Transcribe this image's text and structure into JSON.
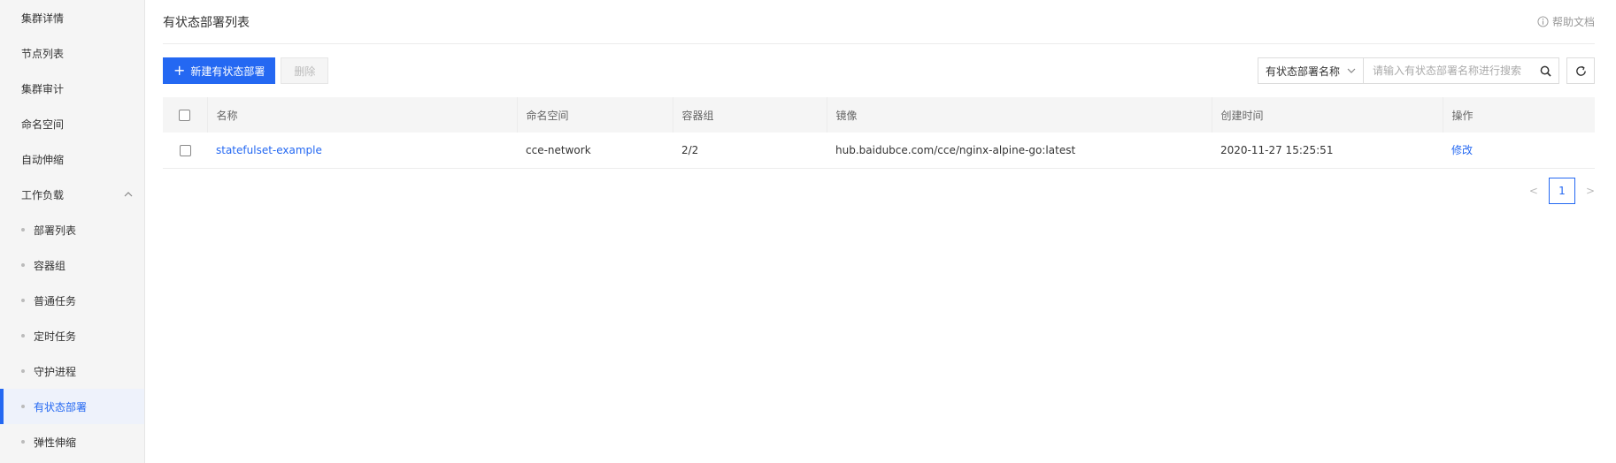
{
  "sidebar": {
    "items": [
      {
        "label": "集群详情"
      },
      {
        "label": "节点列表"
      },
      {
        "label": "集群审计"
      },
      {
        "label": "命名空间"
      },
      {
        "label": "自动伸缩"
      }
    ],
    "group": {
      "label": "工作负载",
      "expanded": true
    },
    "sub_items": [
      {
        "label": "部署列表"
      },
      {
        "label": "容器组"
      },
      {
        "label": "普通任务"
      },
      {
        "label": "定时任务"
      },
      {
        "label": "守护进程"
      },
      {
        "label": "有状态部署",
        "active": true
      },
      {
        "label": "弹性伸缩"
      }
    ]
  },
  "header": {
    "title": "有状态部署列表",
    "help_label": "帮助文档"
  },
  "toolbar": {
    "create_label": "新建有状态部署",
    "delete_label": "删除",
    "search_field": "有状态部署名称",
    "search_placeholder": "请输入有状态部署名称进行搜索"
  },
  "table": {
    "columns": [
      "名称",
      "命名空间",
      "容器组",
      "镜像",
      "创建时间",
      "操作"
    ],
    "rows": [
      {
        "name": "statefulset-example",
        "namespace": "cce-network",
        "pods": "2/2",
        "image": "hub.baidubce.com/cce/nginx-alpine-go:latest",
        "created": "2020-11-27 15:25:51",
        "action": "修改"
      }
    ]
  },
  "pagination": {
    "prev": "<",
    "current": "1",
    "next": ">"
  },
  "colors": {
    "accent": "#2468f2",
    "sidebar_bg": "#f5f5f5"
  }
}
